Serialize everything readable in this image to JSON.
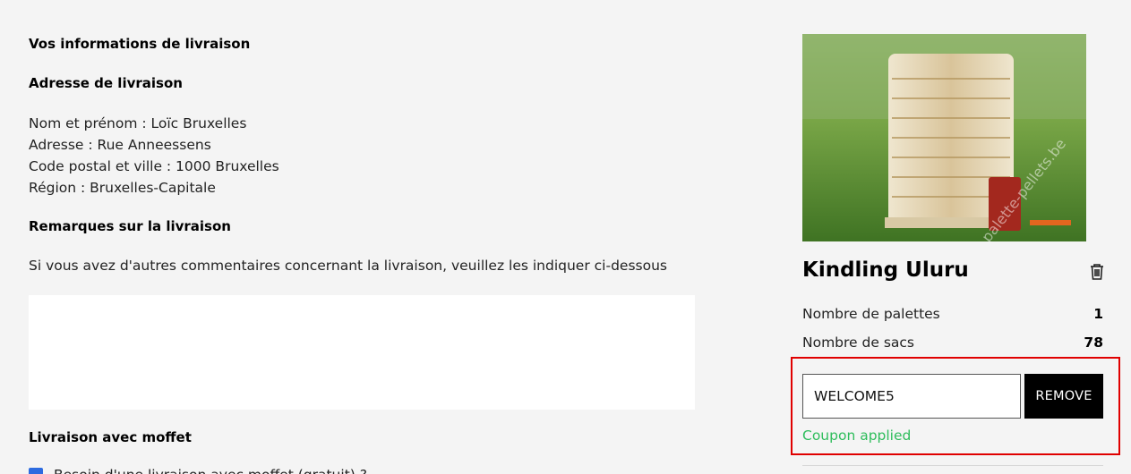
{
  "delivery": {
    "title": "Vos informations de livraison",
    "address_heading": "Adresse de livraison",
    "name_line": "Nom et prénom : Loïc Bruxelles",
    "address_line": "Adresse : Rue Anneessens",
    "postal_line": "Code postal et ville : 1000 Bruxelles",
    "region_line": "Région : Bruxelles-Capitale",
    "remarks_heading": "Remarques sur la livraison",
    "remarks_text": "Si vous avez d'autres commentaires concernant la livraison, veuillez les indiquer ci-dessous",
    "remarks_value": "",
    "moffet_heading": "Livraison avec moffet",
    "moffet_label": "Besoin d'une livraison avec moffet (gratuit) ?",
    "moffet_checked": true
  },
  "product": {
    "image_watermark": "palette-pellets.be",
    "name": "Kindling Uluru",
    "rows": [
      {
        "label": "Nombre de palettes",
        "value": "1"
      },
      {
        "label": "Nombre de sacs",
        "value": "78"
      }
    ]
  },
  "coupon": {
    "value": "WELCOME5",
    "remove_label": "REMOVE",
    "status": "Coupon applied",
    "status_color": "#2fbd5c",
    "highlight_color": "#e00000"
  },
  "icons": {
    "trash": "trash-icon",
    "checkbox": "checkbox-checked-icon"
  }
}
